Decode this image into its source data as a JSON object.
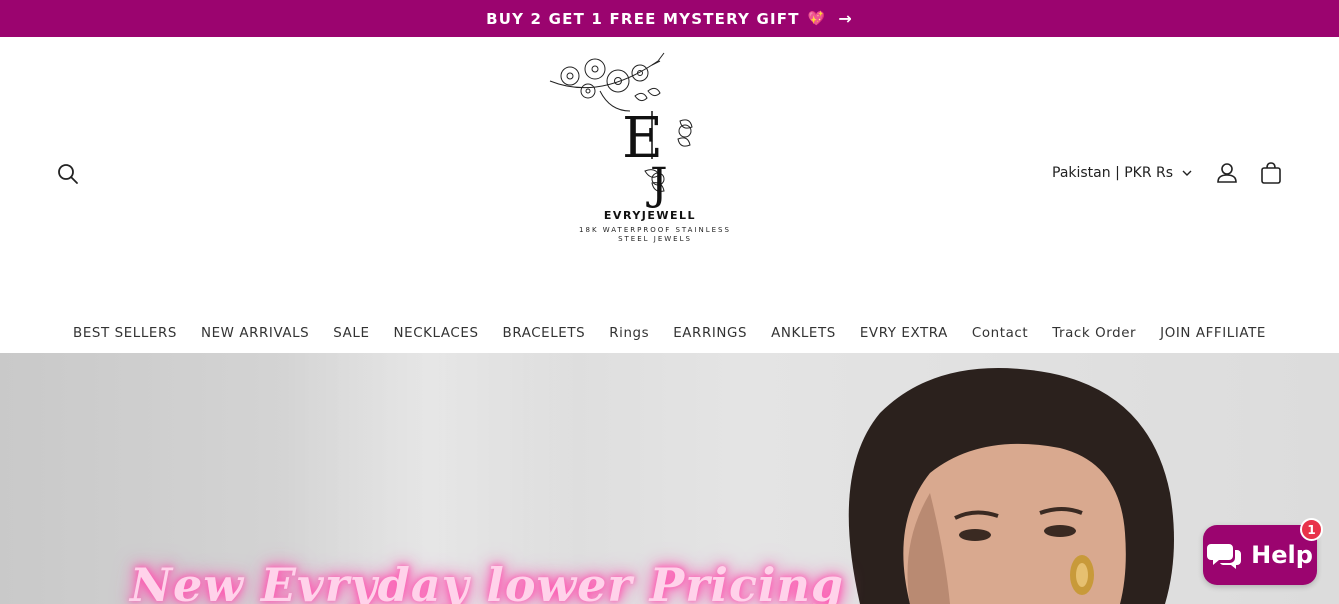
{
  "announcement": {
    "text": "BUY 2 GET 1 FREE MYSTERY GIFT",
    "heart_icon": "💖",
    "arrow_icon": "→"
  },
  "header": {
    "logo": {
      "brand": "EVRYJEWELL",
      "tagline_line1": "18K WATERPROOF STAINLESS",
      "tagline_line2": "STEEL JEWELS"
    },
    "locale_label": "Pakistan | PKR Rs",
    "icons": [
      "search-icon",
      "account-icon",
      "cart-icon",
      "chevron-down-icon"
    ]
  },
  "nav": {
    "items": [
      {
        "label": "BEST SELLERS"
      },
      {
        "label": "NEW ARRIVALS"
      },
      {
        "label": "SALE"
      },
      {
        "label": "NECKLACES"
      },
      {
        "label": "BRACELETS"
      },
      {
        "label": "Rings"
      },
      {
        "label": "EARRINGS"
      },
      {
        "label": "ANKLETS"
      },
      {
        "label": "EVRY EXTRA"
      },
      {
        "label": "Contact"
      },
      {
        "label": "Track Order"
      },
      {
        "label": "JOIN AFFILIATE"
      }
    ]
  },
  "hero": {
    "title": "New Evryday lower Pricing"
  },
  "help_widget": {
    "label": "Help",
    "badge_count": "1"
  },
  "colors": {
    "brand": "#9b046f",
    "neon_pink": "#ff5fb5",
    "badge_red": "#e8334a"
  }
}
